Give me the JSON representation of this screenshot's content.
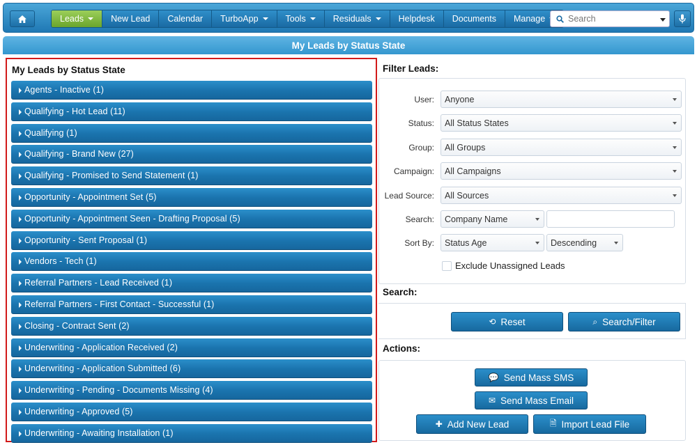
{
  "nav": {
    "home_icon": "home-icon",
    "items": [
      {
        "label": "Leads",
        "dropdown": true,
        "active": true
      },
      {
        "label": "New Lead",
        "dropdown": false
      },
      {
        "label": "Calendar",
        "dropdown": false
      },
      {
        "label": "TurboApp",
        "dropdown": true
      },
      {
        "label": "Tools",
        "dropdown": true
      },
      {
        "label": "Residuals",
        "dropdown": true
      },
      {
        "label": "Helpdesk",
        "dropdown": false
      },
      {
        "label": "Documents",
        "dropdown": false
      },
      {
        "label": "Manage",
        "dropdown": true
      }
    ],
    "search_placeholder": "Search",
    "mic_icon": "microphone-icon"
  },
  "page": {
    "title": "My Leads by Status State"
  },
  "leads": {
    "heading": "My Leads by Status State",
    "statuses": [
      "Agents - Inactive (1)",
      "Qualifying - Hot Lead (11)",
      "Qualifying (1)",
      "Qualifying - Brand New (27)",
      "Qualifying - Promised to Send Statement (1)",
      "Opportunity - Appointment Set (5)",
      "Opportunity - Appointment Seen - Drafting Proposal (5)",
      "Opportunity - Sent Proposal (1)",
      "Vendors - Tech (1)",
      "Referral Partners - Lead Received (1)",
      "Referral Partners - First Contact - Successful (1)",
      "Closing - Contract Sent (2)",
      "Underwriting - Application Received (2)",
      "Underwriting - Application Submitted (6)",
      "Underwriting - Pending - Documents Missing (4)",
      "Underwriting - Approved (5)",
      "Underwriting - Awaiting Installation (1)"
    ]
  },
  "filter": {
    "heading": "Filter Leads:",
    "user_label": "User:",
    "user_value": "Anyone",
    "status_label": "Status:",
    "status_value": "All Status States",
    "group_label": "Group:",
    "group_value": "All Groups",
    "campaign_label": "Campaign:",
    "campaign_value": "All Campaigns",
    "source_label": "Lead Source:",
    "source_value": "All Sources",
    "search_label": "Search:",
    "search_field_value": "Company Name",
    "search_text_value": "",
    "sort_label": "Sort By:",
    "sort_value": "Status Age",
    "sort_dir_value": "Descending",
    "exclude_label": "Exclude Unassigned Leads"
  },
  "search": {
    "heading": "Search:",
    "reset_label": "Reset",
    "filter_label": "Search/Filter"
  },
  "actions": {
    "heading": "Actions:",
    "sms_label": "Send Mass SMS",
    "email_label": "Send Mass Email",
    "add_label": "Add New Lead",
    "import_label": "Import Lead File"
  }
}
